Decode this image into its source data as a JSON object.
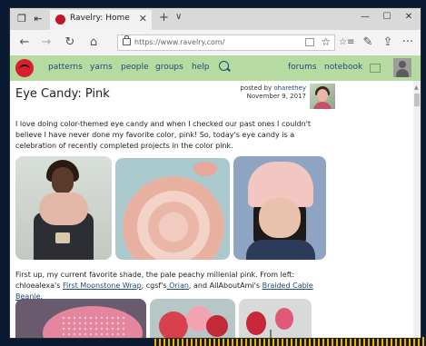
{
  "browser": {
    "tab_title": "Ravelry: Home",
    "url": "https://www.ravelry.com/",
    "icons": {
      "tab_manager": "tab-manager-icon",
      "tab_aside": "tab-aside-icon",
      "back": "back-arrow-icon",
      "forward": "forward-arrow-icon",
      "refresh": "refresh-icon",
      "home": "home-icon",
      "lock": "lock-icon",
      "reading_view": "reading-view-icon",
      "favorite": "star-icon",
      "favorites_hub": "favorites-list-icon",
      "notes": "pen-icon",
      "share": "share-icon",
      "more": "more-icon"
    }
  },
  "glyphs": {
    "tab_close": "✕",
    "new_tab": "+",
    "tab_dropdown": "∨",
    "minimize": "—",
    "maximize": "☐",
    "close": "✕",
    "back": "←",
    "forward": "→",
    "refresh": "↻",
    "home": "⌂",
    "star": "☆",
    "favorites": "☆≡",
    "notes": "✎",
    "share": "⇪",
    "more": "···"
  },
  "ravelry_nav": {
    "links": [
      "patterns",
      "yarns",
      "people",
      "groups",
      "help"
    ],
    "right_links": [
      "forums",
      "notebook"
    ],
    "accent": "#b5dba0"
  },
  "post": {
    "title": "Eye Candy: Pink",
    "posted_by_label": "posted by",
    "author": "oharethey",
    "date": "November 9, 2017",
    "intro": "I love doing color-themed eye candy and when I checked our past ones I couldn't believe I have never done my favorite color, pink! So, today's eye candy is a celebration of recently completed projects in the color pink.",
    "caption_start": "First up, my current favorite shade, the pale peachy millenial pink. From left: chloealexa's",
    "link1": "First Moonstone Wrap",
    "caption_mid1": ", cgsf's",
    "link2": " Orian",
    "caption_mid2": ", and AllAboutAmi's ",
    "link3": "Braided Cable Beanie",
    "caption_end": "."
  }
}
